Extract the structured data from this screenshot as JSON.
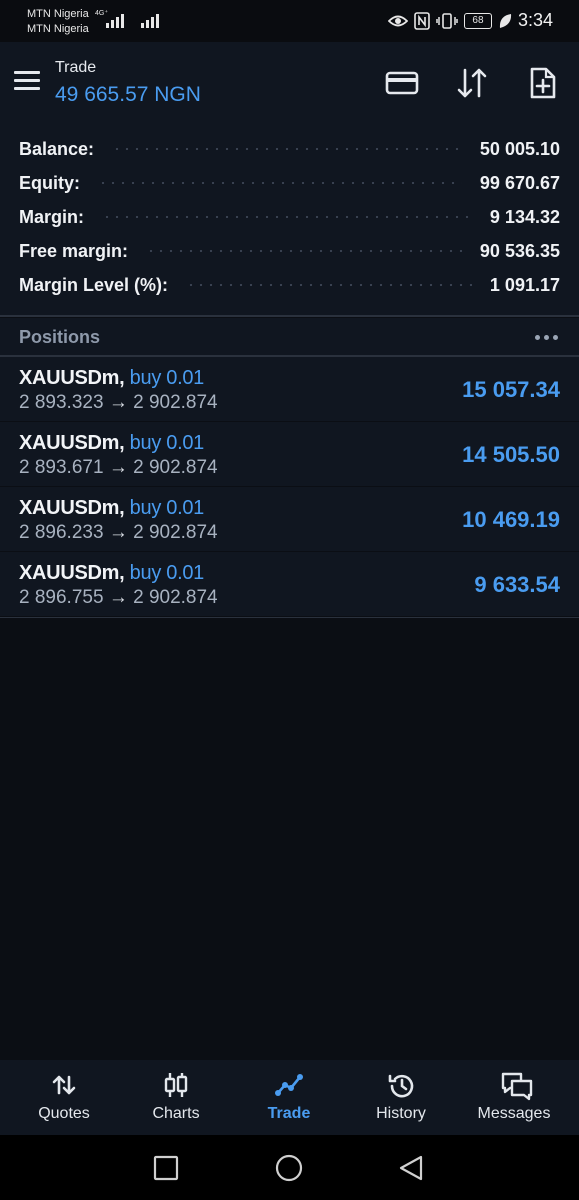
{
  "status_bar": {
    "carrier_1": "MTN Nigeria",
    "carrier_2": "MTN Nigeria",
    "network_type": "4G⁺",
    "battery": "68",
    "time": "3:34"
  },
  "app_bar": {
    "title": "Trade",
    "balance": "49 665.57 NGN",
    "icons": [
      "menu-icon",
      "deposit-card-icon",
      "sort-arrows-icon",
      "new-order-icon"
    ]
  },
  "summary": [
    {
      "label": "Balance:",
      "value": "50 005.10"
    },
    {
      "label": "Equity:",
      "value": "99 670.67"
    },
    {
      "label": "Margin:",
      "value": "9 134.32"
    },
    {
      "label": "Free margin:",
      "value": "90 536.35"
    },
    {
      "label": "Margin Level (%):",
      "value": "1 091.17"
    }
  ],
  "positions": {
    "title": "Positions",
    "items": [
      {
        "symbol": "XAUUSDm,",
        "side": "buy 0.01",
        "open": "2 893.323",
        "arrow": "→",
        "current": "2 902.874",
        "profit": "15 057.34"
      },
      {
        "symbol": "XAUUSDm,",
        "side": "buy 0.01",
        "open": "2 893.671",
        "arrow": "→",
        "current": "2 902.874",
        "profit": "14 505.50"
      },
      {
        "symbol": "XAUUSDm,",
        "side": "buy 0.01",
        "open": "2 896.233",
        "arrow": "→",
        "current": "2 902.874",
        "profit": "10 469.19"
      },
      {
        "symbol": "XAUUSDm,",
        "side": "buy 0.01",
        "open": "2 896.755",
        "arrow": "→",
        "current": "2 902.874",
        "profit": "9 633.54"
      }
    ]
  },
  "bottom_nav": {
    "active": "Trade",
    "items": [
      {
        "label": "Quotes",
        "icon": "quotes-arrows-icon"
      },
      {
        "label": "Charts",
        "icon": "candlestick-icon"
      },
      {
        "label": "Trade",
        "icon": "trade-line-icon"
      },
      {
        "label": "History",
        "icon": "history-clock-icon"
      },
      {
        "label": "Messages",
        "icon": "messages-icon"
      }
    ]
  },
  "colors": {
    "background": "#0b0e14",
    "panel": "#101620",
    "accent": "#4a9cf0",
    "text": "#f0f2f5",
    "muted": "#8e99aa"
  }
}
